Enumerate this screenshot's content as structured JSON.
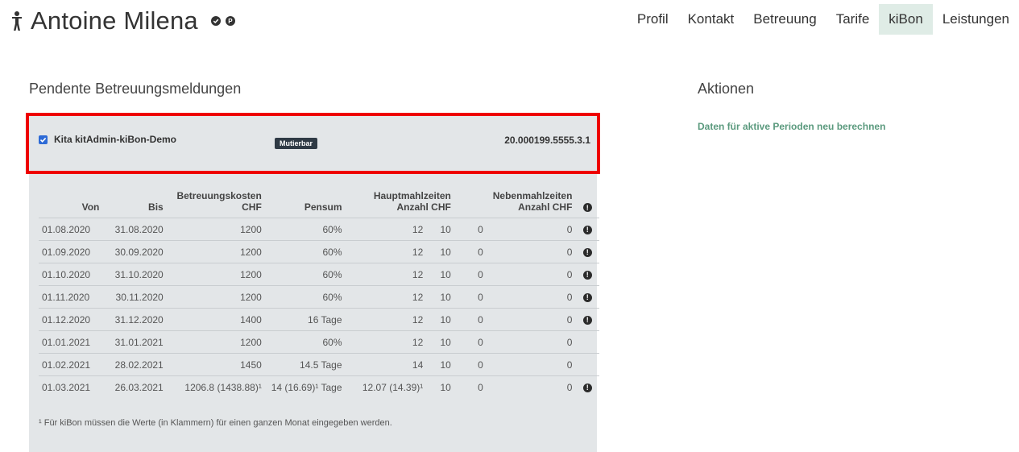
{
  "header": {
    "title": "Antoine Milena",
    "icons": [
      "child-icon",
      "check-circle-icon",
      "p-badge-icon"
    ],
    "p_badge_text": "P",
    "nav": [
      {
        "label": "Profil",
        "active": false
      },
      {
        "label": "Kontakt",
        "active": false
      },
      {
        "label": "Betreuung",
        "active": false
      },
      {
        "label": "Tarife",
        "active": false
      },
      {
        "label": "kiBon",
        "active": true
      },
      {
        "label": "Leistungen",
        "active": false
      }
    ]
  },
  "pending": {
    "title": "Pendente Betreuungsmeldungen",
    "institution": "Kita kitAdmin-kiBon-Demo",
    "status": "Mutierbar",
    "reference": "20.000199.5555.3.1",
    "checked": true,
    "table": {
      "headers": {
        "von": "Von",
        "bis": "Bis",
        "kosten_1": "Betreuungskosten",
        "kosten_2": "CHF",
        "pensum": "Pensum",
        "haupt_1": "Hauptmahlzeiten",
        "haupt_2": "Anzahl CHF",
        "neben_1": "Nebenmahlzeiten",
        "neben_2": "Anzahl CHF"
      },
      "rows": [
        {
          "von": "01.08.2020",
          "bis": "31.08.2020",
          "kosten": "1200",
          "pensum": "60%",
          "haupt_anzahl": "12",
          "haupt_chf": "10",
          "neben_anzahl": "0",
          "neben_chf": "0",
          "info": true
        },
        {
          "von": "01.09.2020",
          "bis": "30.09.2020",
          "kosten": "1200",
          "pensum": "60%",
          "haupt_anzahl": "12",
          "haupt_chf": "10",
          "neben_anzahl": "0",
          "neben_chf": "0",
          "info": true
        },
        {
          "von": "01.10.2020",
          "bis": "31.10.2020",
          "kosten": "1200",
          "pensum": "60%",
          "haupt_anzahl": "12",
          "haupt_chf": "10",
          "neben_anzahl": "0",
          "neben_chf": "0",
          "info": true
        },
        {
          "von": "01.11.2020",
          "bis": "30.11.2020",
          "kosten": "1200",
          "pensum": "60%",
          "haupt_anzahl": "12",
          "haupt_chf": "10",
          "neben_anzahl": "0",
          "neben_chf": "0",
          "info": true
        },
        {
          "von": "01.12.2020",
          "bis": "31.12.2020",
          "kosten": "1400",
          "pensum": "16 Tage",
          "haupt_anzahl": "12",
          "haupt_chf": "10",
          "neben_anzahl": "0",
          "neben_chf": "0",
          "info": true
        },
        {
          "von": "01.01.2021",
          "bis": "31.01.2021",
          "kosten": "1200",
          "pensum": "60%",
          "haupt_anzahl": "12",
          "haupt_chf": "10",
          "neben_anzahl": "0",
          "neben_chf": "0",
          "info": false
        },
        {
          "von": "01.02.2021",
          "bis": "28.02.2021",
          "kosten": "1450",
          "pensum": "14.5 Tage",
          "haupt_anzahl": "14",
          "haupt_chf": "10",
          "neben_anzahl": "0",
          "neben_chf": "0",
          "info": false
        },
        {
          "von": "01.03.2021",
          "bis": "26.03.2021",
          "kosten": "1206.8 (1438.88)¹",
          "pensum": "14 (16.69)¹ Tage",
          "haupt_anzahl": "12.07 (14.39)¹",
          "haupt_chf": "10",
          "neben_anzahl": "0",
          "neben_chf": "0",
          "info": true
        }
      ]
    },
    "footnote": "¹ Für kiBon müssen die Werte (in Klammern) für einen ganzen Monat eingegeben werden."
  },
  "actions": {
    "title": "Aktionen",
    "recalculate": "Daten für aktive Perioden neu berechnen"
  },
  "info_icon_text": "!",
  "colors": {
    "highlight": "#ee0000",
    "panel_bg": "#e3e6e8",
    "active_tab": "#dfece6",
    "link": "#5b9a7e",
    "checkbox": "#2d6ad6",
    "status_label": "#2f3a45"
  }
}
